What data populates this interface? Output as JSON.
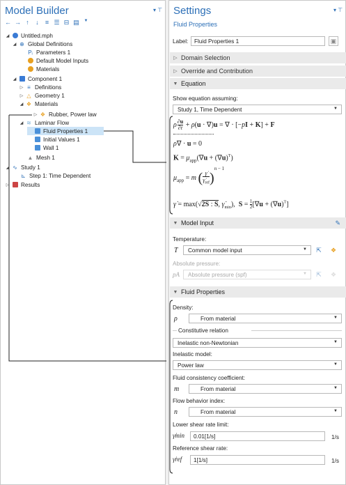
{
  "model_builder": {
    "title": "Model Builder",
    "tree": [
      {
        "label": "Untitled.mph",
        "icon": "model-file-icon"
      },
      {
        "label": "Global Definitions",
        "icon": "globe-icon"
      },
      {
        "label": "Parameters 1",
        "icon": "parameters-icon",
        "glyph": "Pᵢ"
      },
      {
        "label": "Default Model Inputs",
        "icon": "model-inputs-icon"
      },
      {
        "label": "Materials",
        "icon": "materials-icon"
      },
      {
        "label": "Component 1",
        "icon": "component-icon"
      },
      {
        "label": "Definitions",
        "icon": "definitions-icon",
        "glyph": "≡"
      },
      {
        "label": "Geometry 1",
        "icon": "geometry-icon"
      },
      {
        "label": "Materials",
        "icon": "materials-icon"
      },
      {
        "label": "Rubber, Power law",
        "icon": "material-icon"
      },
      {
        "label": "Laminar Flow",
        "icon": "laminar-flow-icon"
      },
      {
        "label": "Fluid Properties 1",
        "icon": "fluid-properties-icon"
      },
      {
        "label": "Initial Values 1",
        "icon": "initial-values-icon"
      },
      {
        "label": "Wall 1",
        "icon": "wall-icon"
      },
      {
        "label": "Mesh 1",
        "icon": "mesh-icon"
      },
      {
        "label": "Study 1",
        "icon": "study-icon"
      },
      {
        "label": "Step 1: Time Dependent",
        "icon": "time-dependent-step-icon"
      },
      {
        "label": "Results",
        "icon": "results-icon"
      }
    ]
  },
  "settings": {
    "title": "Settings",
    "subtitle": "Fluid Properties",
    "label_caption": "Label:",
    "label_value": "Fluid Properties 1",
    "sections": {
      "domain_selection": "Domain Selection",
      "override": "Override and Contribution",
      "equation": "Equation",
      "model_input": "Model Input",
      "fluid_properties": "Fluid Properties"
    },
    "equation": {
      "show_label": "Show equation assuming:",
      "show_value": "Study 1, Time Dependent"
    },
    "model_input": {
      "temperature_label": "Temperature:",
      "temperature_symbol": "T",
      "temperature_value": "Common model input",
      "pressure_label": "Absolute pressure:",
      "pressure_symbol": "pA",
      "pressure_value": "Absolute pressure (spf)"
    },
    "fluid": {
      "density_label": "Density:",
      "density_symbol": "ρ",
      "density_value": "From material",
      "constitutive_label": "Constitutive relation",
      "constitutive_value": "Inelastic non-Newtonian",
      "inelastic_label": "Inelastic model:",
      "inelastic_value": "Power law",
      "consistency_label": "Fluid consistency coefficient:",
      "consistency_symbol": "m",
      "consistency_value": "From material",
      "flow_index_label": "Flow behavior index:",
      "flow_index_symbol": "n",
      "flow_index_value": "From material",
      "lower_limit_label": "Lower shear rate limit:",
      "lower_limit_symbol": "γ̇min",
      "lower_limit_value": "0.01[1/s]",
      "lower_limit_unit": "1/s",
      "ref_rate_label": "Reference shear rate:",
      "ref_rate_symbol": "γ̇ref",
      "ref_rate_value": "1[1/s]",
      "ref_rate_unit": "1/s"
    }
  },
  "colors": {
    "title_blue": "#2c6fb7",
    "selection": "#cce4f7",
    "section_bg": "#eaeaea",
    "materials_orange": "#e8a020"
  }
}
